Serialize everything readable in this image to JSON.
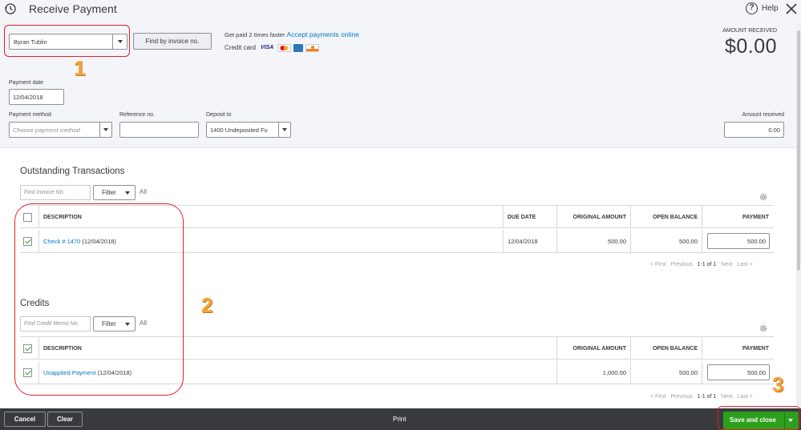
{
  "header": {
    "title": "Receive Payment",
    "help_label": "Help",
    "customer_value": "Byran Tublin",
    "find_invoice_label": "Find by invoice no.",
    "get_paid_text": "Get paid 2 times faster",
    "accept_link": "Accept payments online",
    "credit_card_label": "Credit card",
    "visa_text": "VISA",
    "amount_received_label": "AMOUNT RECEIVED",
    "amount_received_value": "$0.00"
  },
  "form": {
    "payment_date_label": "Payment date",
    "payment_date_value": "12/04/2018",
    "payment_method_label": "Payment method",
    "payment_method_placeholder": "Choose payment method",
    "reference_label": "Reference no.",
    "reference_value": "",
    "deposit_label": "Deposit to",
    "deposit_value": "1400 Undeposited Fu",
    "amount_received_label": "Amount received",
    "amount_received_value": "0.00"
  },
  "outstanding": {
    "title": "Outstanding Transactions",
    "find_placeholder": "Find Invoice No.",
    "filter_label": "Filter",
    "all_label": "All",
    "columns": [
      "DESCRIPTION",
      "DUE DATE",
      "ORIGINAL AMOUNT",
      "OPEN BALANCE",
      "PAYMENT"
    ],
    "rows": [
      {
        "link": "Check # 1470",
        "date_suffix": "(12/04/2018)",
        "due_date": "12/04/2018",
        "original": "500.00",
        "open": "500.00",
        "payment": "500.00",
        "checked": true
      }
    ],
    "pager": {
      "first": "< First",
      "previous": "Previous",
      "current": "1-1 of 1",
      "next": "Next",
      "last": "Last >"
    }
  },
  "credits": {
    "title": "Credits",
    "find_placeholder": "Find Credit Memo No.",
    "filter_label": "Filter",
    "all_label": "All",
    "columns": [
      "DESCRIPTION",
      "ORIGINAL AMOUNT",
      "OPEN BALANCE",
      "PAYMENT"
    ],
    "rows": [
      {
        "link": "Unapplied Payment",
        "date_suffix": "(12/04/2018)",
        "original": "1,000.00",
        "open": "500.00",
        "payment": "500.00",
        "checked": true
      }
    ],
    "pager": {
      "first": "< First",
      "previous": "Previous",
      "current": "1-1 of 1",
      "next": "Next",
      "last": "Last >"
    }
  },
  "footer": {
    "cancel_label": "Cancel",
    "clear_label": "Clear",
    "print_label": "Print",
    "save_label": "Save and close"
  },
  "annotations": {
    "one": "1",
    "two": "2",
    "three": "3"
  },
  "colors": {
    "accent_green": "#2ca01c",
    "link_blue": "#0077c5",
    "annotation_orange": "#f7a23b",
    "annotation_red": "#e0202a",
    "footer_dark": "#393a3d"
  }
}
